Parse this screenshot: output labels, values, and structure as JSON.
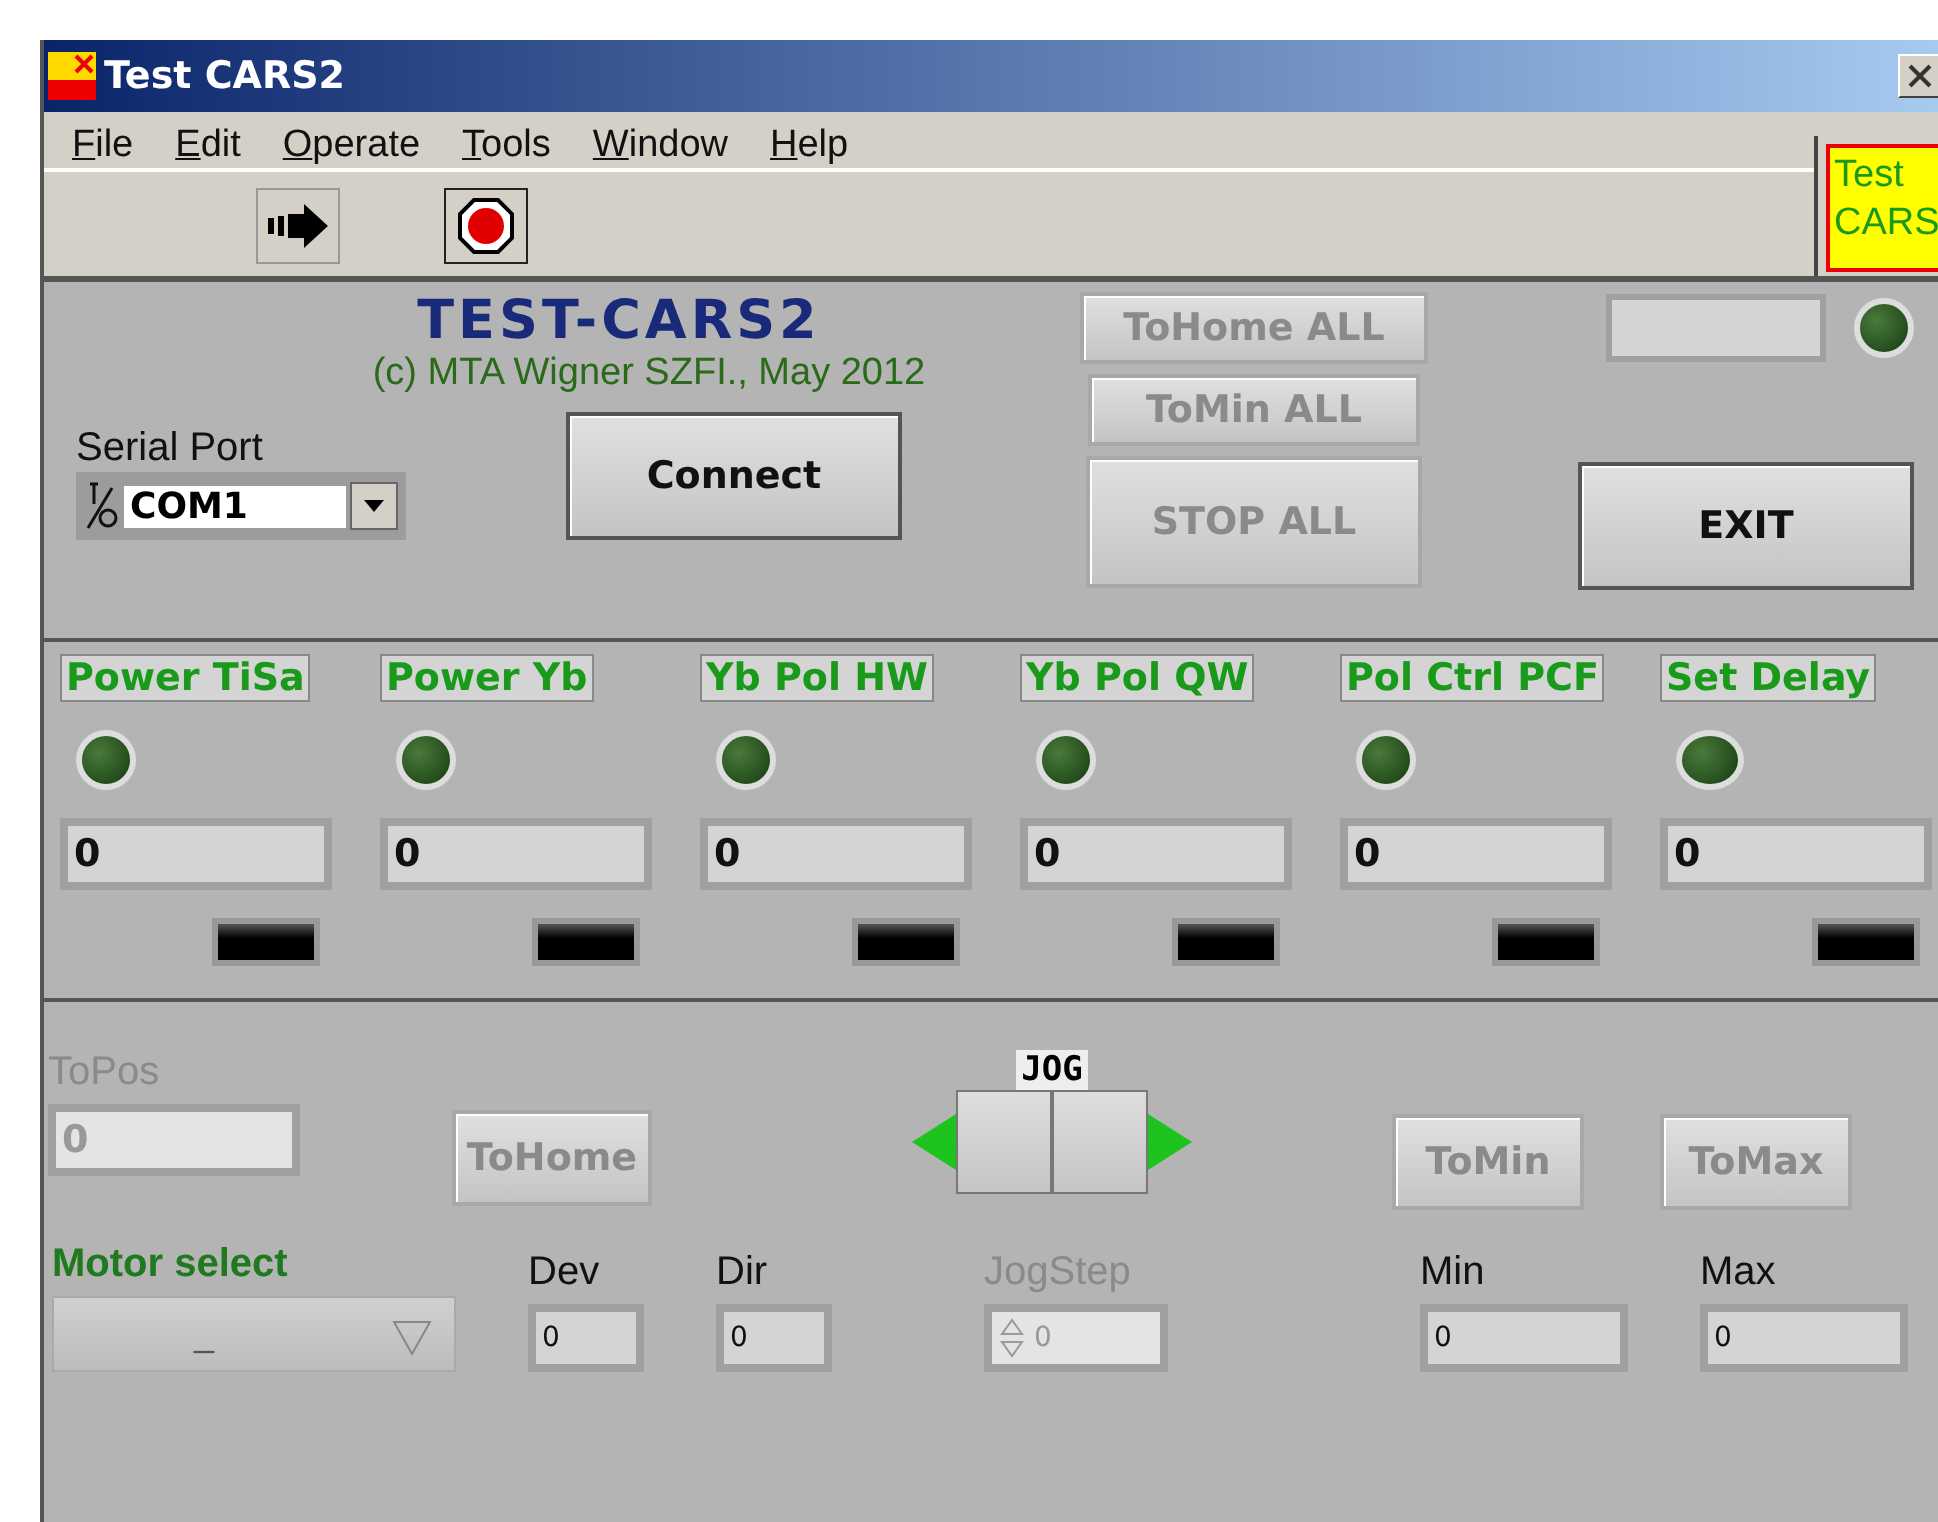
{
  "window": {
    "title": "Test CARS2"
  },
  "menu": [
    {
      "label": "File"
    },
    {
      "label": "Edit"
    },
    {
      "label": "Operate"
    },
    {
      "label": "Tools"
    },
    {
      "label": "Window"
    },
    {
      "label": "Help"
    }
  ],
  "vi_icon": {
    "lines": [
      "Test",
      "CARS"
    ]
  },
  "toolbar": [
    {
      "kind": "run"
    },
    {
      "kind": "stop"
    }
  ],
  "header": {
    "title": "TEST-CARS2",
    "subtitle": "(c) MTA Wigner SZFI., May 2012"
  },
  "serial_port": {
    "label": "Serial Port",
    "value": "COM1"
  },
  "connect_button": {
    "label": "Connect",
    "disabled": false
  },
  "all_buttons": [
    {
      "label": "ToHome ALL",
      "disabled": true
    },
    {
      "label": "ToMin ALL",
      "disabled": true
    },
    {
      "label": "STOP ALL",
      "disabled": true
    }
  ],
  "status": {
    "led_on": false
  },
  "exit_button": {
    "label": "EXIT",
    "disabled": false
  },
  "channels": [
    {
      "name": "Power TiSa",
      "led_on": false,
      "value": "0"
    },
    {
      "name": "Power Yb",
      "led_on": false,
      "value": "0"
    },
    {
      "name": "Yb Pol HW",
      "led_on": false,
      "value": "0"
    },
    {
      "name": "Yb Pol QW",
      "led_on": false,
      "value": "0"
    },
    {
      "name": "Pol Ctrl PCF",
      "led_on": false,
      "value": "0"
    },
    {
      "name": "Set Delay",
      "led_on": false,
      "value": "0"
    }
  ],
  "to_pos": {
    "label": "ToPos",
    "value": "0",
    "disabled": true
  },
  "motion_buttons": [
    {
      "label": "ToHome",
      "disabled": true
    },
    {
      "label": "ToMin",
      "disabled": true
    },
    {
      "label": "ToMax",
      "disabled": true
    }
  ],
  "jog": {
    "label": "JOG"
  },
  "motor_select": {
    "label": "Motor select",
    "value": "_"
  },
  "fields": [
    {
      "label": "Dev",
      "value": "0",
      "disabled": false
    },
    {
      "label": "Dir",
      "value": "0",
      "disabled": false
    },
    {
      "label": "JogStep",
      "value": "0",
      "disabled": true,
      "kind": "spin"
    },
    {
      "label": "Min",
      "value": "0",
      "disabled": false
    },
    {
      "label": "Max",
      "value": "0",
      "disabled": false
    }
  ]
}
